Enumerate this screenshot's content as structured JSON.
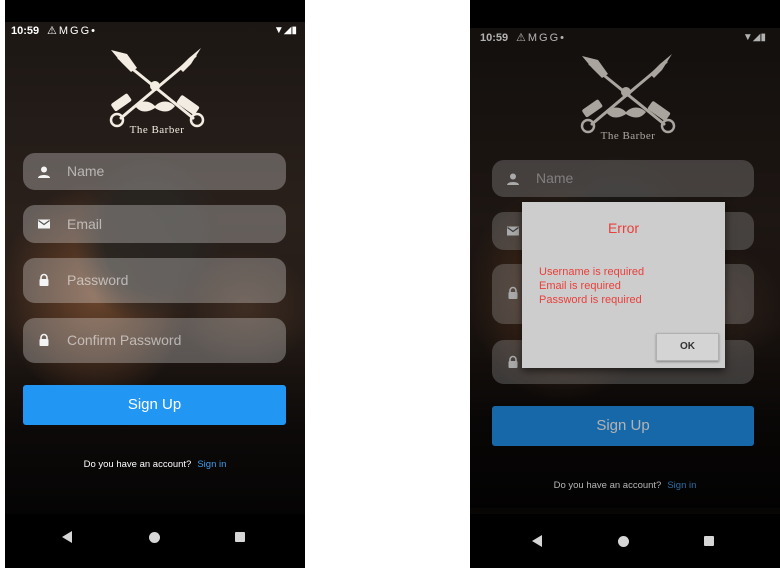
{
  "status_bar": {
    "time": "10:59",
    "notification_icons": [
      "alert-icon",
      "gmail-icon",
      "google-icon",
      "google-icon",
      "dot-icon"
    ],
    "status_icons": [
      "wifi-icon",
      "signal-icon",
      "battery-icon"
    ]
  },
  "brand": {
    "logo_text": "The Barber"
  },
  "form": {
    "name_placeholder": "Name",
    "email_placeholder": "Email",
    "password_placeholder": "Password",
    "confirm_password_placeholder": "Confirm Password",
    "signup_label": "Sign Up",
    "account_prompt": "Do you have an account?",
    "signin_link": "Sign in"
  },
  "dialog": {
    "title": "Error",
    "messages": [
      "Username is required",
      "Email is required",
      "Password is required"
    ],
    "ok_label": "OK"
  },
  "colors": {
    "signup_button": "#2196f3",
    "signup_button_dimmed": "#155c97",
    "link": "#3f9ce8",
    "error_text": "#e8403b",
    "dialog_background": "#cdcdcd"
  },
  "nav_bar": {
    "icons": [
      "back-icon",
      "home-icon",
      "recents-icon"
    ]
  }
}
